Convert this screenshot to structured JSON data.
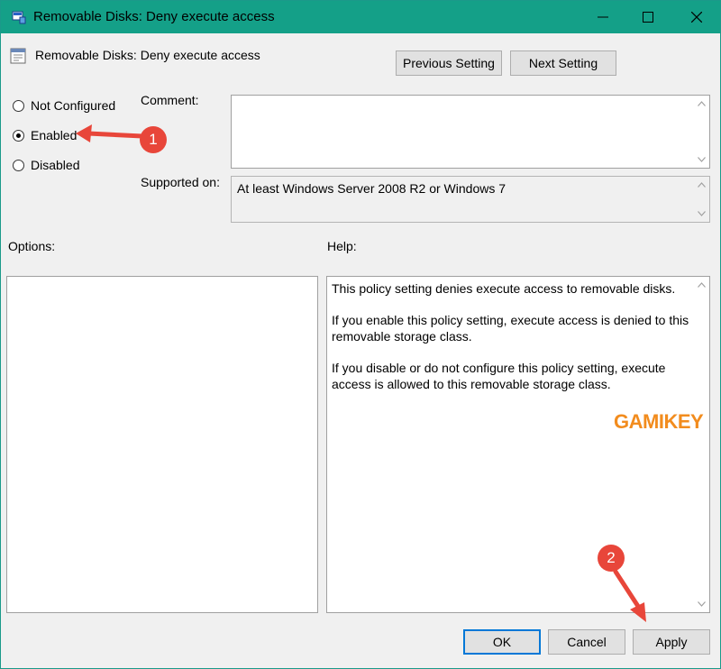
{
  "window": {
    "title": "Removable Disks: Deny execute access",
    "controls": {
      "minimize": "minimize-icon",
      "maximize": "maximize-icon",
      "close": "close-icon"
    }
  },
  "header": {
    "setting_name": "Removable Disks: Deny execute access",
    "previous_label": "Previous Setting",
    "next_label": "Next Setting"
  },
  "state": {
    "options": [
      {
        "label": "Not Configured",
        "selected": false
      },
      {
        "label": "Enabled",
        "selected": true
      },
      {
        "label": "Disabled",
        "selected": false
      }
    ]
  },
  "comment": {
    "label": "Comment:",
    "value": ""
  },
  "supported": {
    "label": "Supported on:",
    "value": "At least Windows Server 2008 R2 or Windows 7"
  },
  "options_panel": {
    "label": "Options:"
  },
  "help_panel": {
    "label": "Help:",
    "paragraphs": [
      "This policy setting denies execute access to removable disks.",
      "If you enable this policy setting, execute access is denied to this removable storage class.",
      "If you disable or do not configure this policy setting, execute access is allowed to this removable storage class."
    ]
  },
  "footer": {
    "ok_label": "OK",
    "cancel_label": "Cancel",
    "apply_label": "Apply"
  },
  "annotations": {
    "step1": "1",
    "step2": "2"
  },
  "watermark": {
    "text_a": "GAMI",
    "text_b": "KEY"
  },
  "colors": {
    "titlebar": "#14a088",
    "accent": "#0078d7",
    "annotation": "#e8463a",
    "watermark": "#f28c1e"
  }
}
